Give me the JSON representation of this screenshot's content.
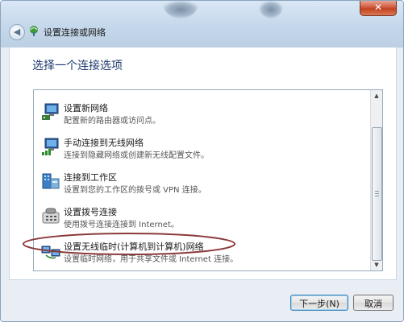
{
  "window": {
    "title": "设置连接或网络",
    "close_glyph": "✕",
    "back_glyph": "◀"
  },
  "main": {
    "heading": "选择一个连接选项"
  },
  "options": [
    {
      "title": "设置新网络",
      "desc": "配置新的路由器或访问点。",
      "icon": "network-monitor-icon"
    },
    {
      "title": "手动连接到无线网络",
      "desc": "连接到隐藏网络或创建新无线配置文件。",
      "icon": "wireless-network-icon"
    },
    {
      "title": "连接到工作区",
      "desc": "设置到您的工作区的拨号或 VPN 连接。",
      "icon": "workplace-icon"
    },
    {
      "title": "设置拨号连接",
      "desc": "使用拨号连接连接到 Internet。",
      "icon": "dialup-phone-icon"
    },
    {
      "title": "设置无线临时(计算机到计算机)网络",
      "desc": "设置临时网络，用于共享文件或 Internet 连接。",
      "icon": "adhoc-network-icon"
    }
  ],
  "buttons": {
    "next": "下一步(N)",
    "cancel": "取消"
  },
  "colors": {
    "heading": "#1e3a6e",
    "highlight_ellipse": "#8b3a3a"
  }
}
